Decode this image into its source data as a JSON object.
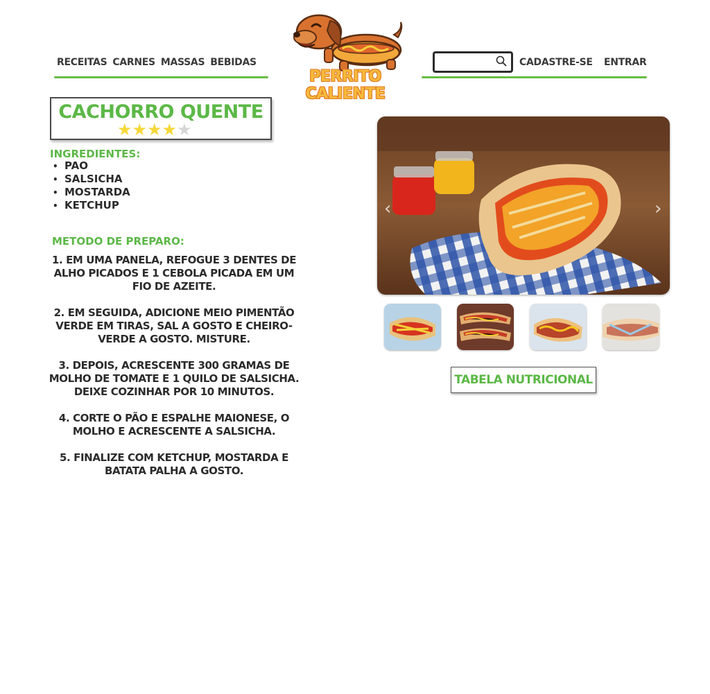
{
  "header": {
    "nav": [
      "Receitas",
      "Carnes",
      "Massas",
      "Bebidas"
    ],
    "logo_text": "Perrito Caliente",
    "search": {
      "placeholder": "",
      "value": ""
    },
    "signup_label": "Cadastre-se",
    "login_label": "Entrar"
  },
  "recipe": {
    "title": "Cachorro Quente",
    "rating": {
      "value": 4,
      "max": 5
    },
    "ingredients_heading": "Ingredientes:",
    "ingredients": [
      "Pao",
      "Salsicha",
      "Mostarda",
      "Ketchup"
    ],
    "method_heading": "Metodo de preparo:",
    "steps": [
      "1. Em uma panela, refogue 3 dentes de alho picados e 1 cebola picada em um fio de azeite.",
      "2. Em seguida, adicione meio pimentão verde em tiras,  sal a gosto e cheiro-verde a gosto. Misture.",
      "3. Depois, acrescente 300 gramas de molho de tomate e 1 quilo de salsicha. Deixe cozinhar por 10 minutos.",
      "4. Corte o pão e espalhe maionese, o molho e acrescente a salsicha.",
      "5. Finalize com ketchup, mostarda e batata palha a gosto."
    ]
  },
  "gallery": {
    "prev_icon": "chevron-left-icon",
    "next_icon": "chevron-right-icon",
    "thumbnails": 4
  },
  "nutrition_button": "Tabela Nutricional",
  "colors": {
    "accent_green": "#5cb847",
    "star": "#f5d83a",
    "logo_orange": "#e07a24"
  }
}
